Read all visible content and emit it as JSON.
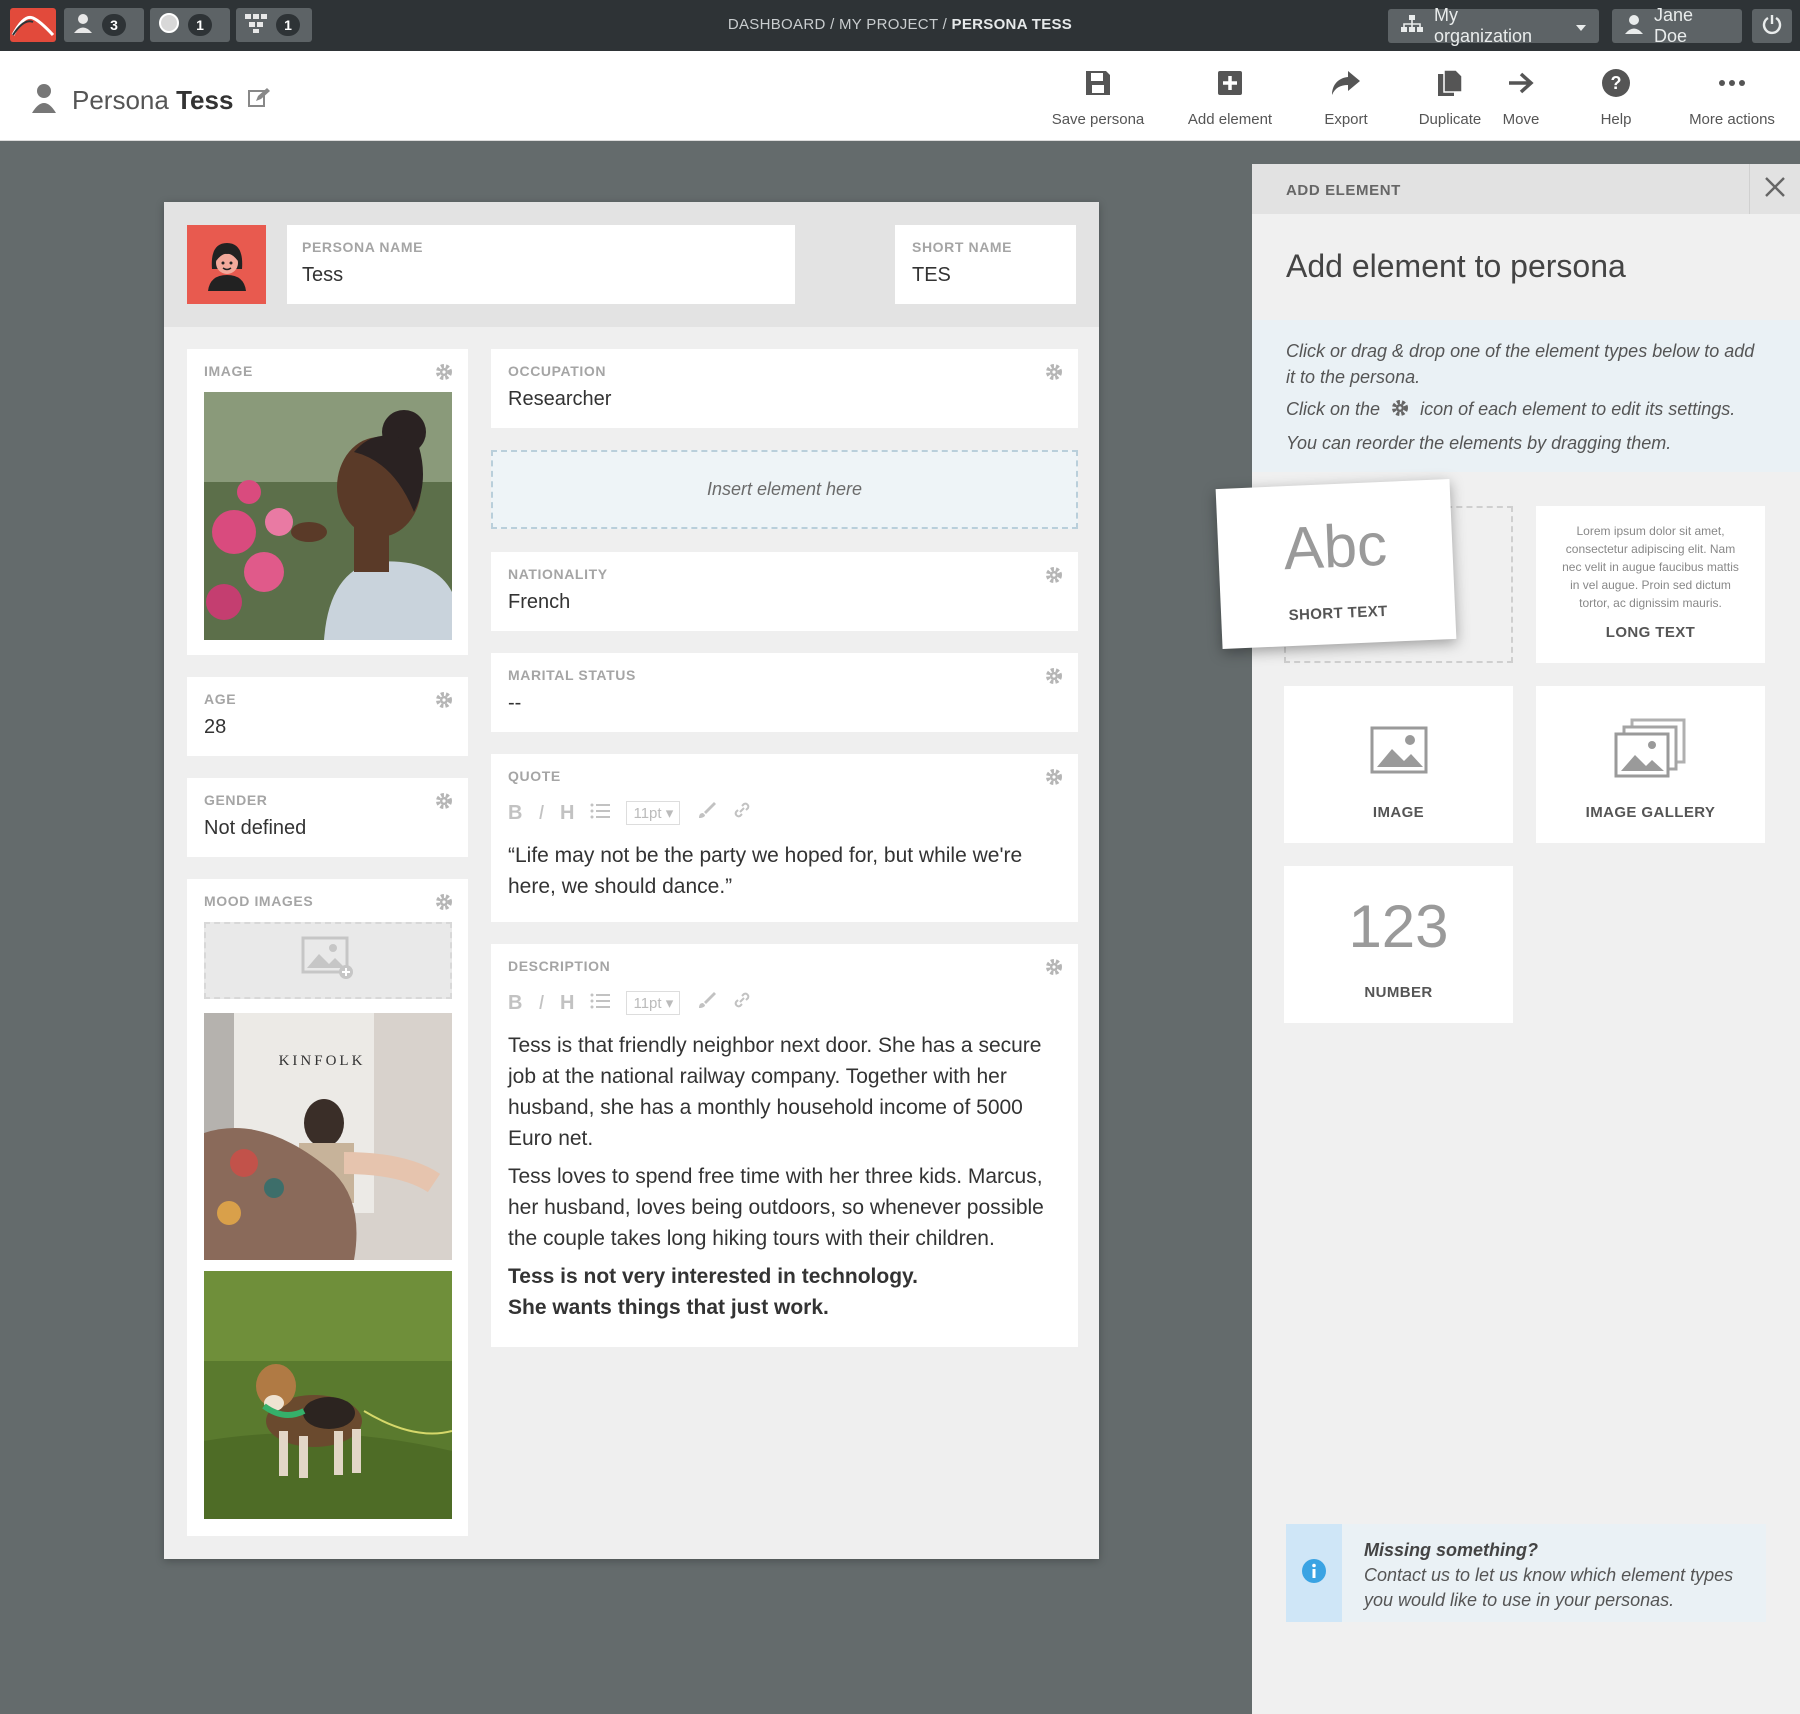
{
  "topbar": {
    "badges": [
      {
        "icon": "user-icon",
        "count": "3"
      },
      {
        "icon": "circle-icon",
        "count": "1"
      },
      {
        "icon": "network-icon",
        "count": "1"
      }
    ],
    "breadcrumb": {
      "part1": "DASHBOARD",
      "sep": "/",
      "part2": "MY PROJECT",
      "current": "PERSONA TESS"
    },
    "organization": "My organization",
    "user": "Jane Doe"
  },
  "toolbar": {
    "title_prefix": "Persona",
    "title_name": "Tess",
    "actions": [
      "Save persona",
      "Add element",
      "Export",
      "Duplicate",
      "Move",
      "Help",
      "More actions"
    ]
  },
  "persona": {
    "name_label": "PERSONA NAME",
    "name": "Tess",
    "short_label": "SHORT NAME",
    "short": "TES",
    "image_label": "IMAGE",
    "age_label": "AGE",
    "age": "28",
    "gender_label": "GENDER",
    "gender": "Not defined",
    "mood_label": "MOOD IMAGES",
    "magazine_title": "KINFOLK",
    "occupation_label": "OCCUPATION",
    "occupation": "Researcher",
    "insert": "Insert element here",
    "nationality_label": "NATIONALITY",
    "nationality": "French",
    "marital_label": "MARITAL STATUS",
    "marital": "--",
    "quote_label": "QUOTE",
    "quote": "“Life may not be the party we hoped for, but while we're here, we should dance.”",
    "description_label": "DESCRIPTION",
    "desc_p1": "Tess is that friendly neighbor next door. She has a secure job at the national railway company. Together with her husband, she has a monthly household income of  5000 Euro net.",
    "desc_p2": "Tess loves to spend free time with her three kids. Marcus, her husband, loves being outdoors, so whenever possible the couple takes long hiking tours with their children.",
    "desc_b1": "Tess is not very interested in technology.",
    "desc_b2": "She wants things that just work.",
    "editor": {
      "bold": "B",
      "italic": "I",
      "heading": "H",
      "size": "11pt"
    }
  },
  "panel": {
    "header": "ADD ELEMENT",
    "title": "Add element to persona",
    "help1": "Click or drag & drop one of the element types below to add it to the persona.",
    "help2a": "Click on the",
    "help2b": "icon of each element to edit its settings.",
    "help3": "You can reorder the elements by dragging them.",
    "tiles": {
      "short_sample": "Abc",
      "short": "SHORT TEXT",
      "long_sample": "Lorem ipsum dolor sit amet, consectetur adipiscing elit. Nam nec velit in augue faucibus mattis in vel augue. Proin sed dictum tortor, ac dignissim mauris.",
      "long": "LONG TEXT",
      "image": "IMAGE",
      "gallery": "IMAGE GALLERY",
      "number_sample": "123",
      "number": "NUMBER"
    },
    "missing_title": "Missing something?",
    "missing_text": "Contact us to let us know which element types you would like to use in your personas."
  },
  "colors": {
    "accent": "#e24a3b",
    "avatar": "#e85a4f",
    "info": "#3aa3e3"
  }
}
